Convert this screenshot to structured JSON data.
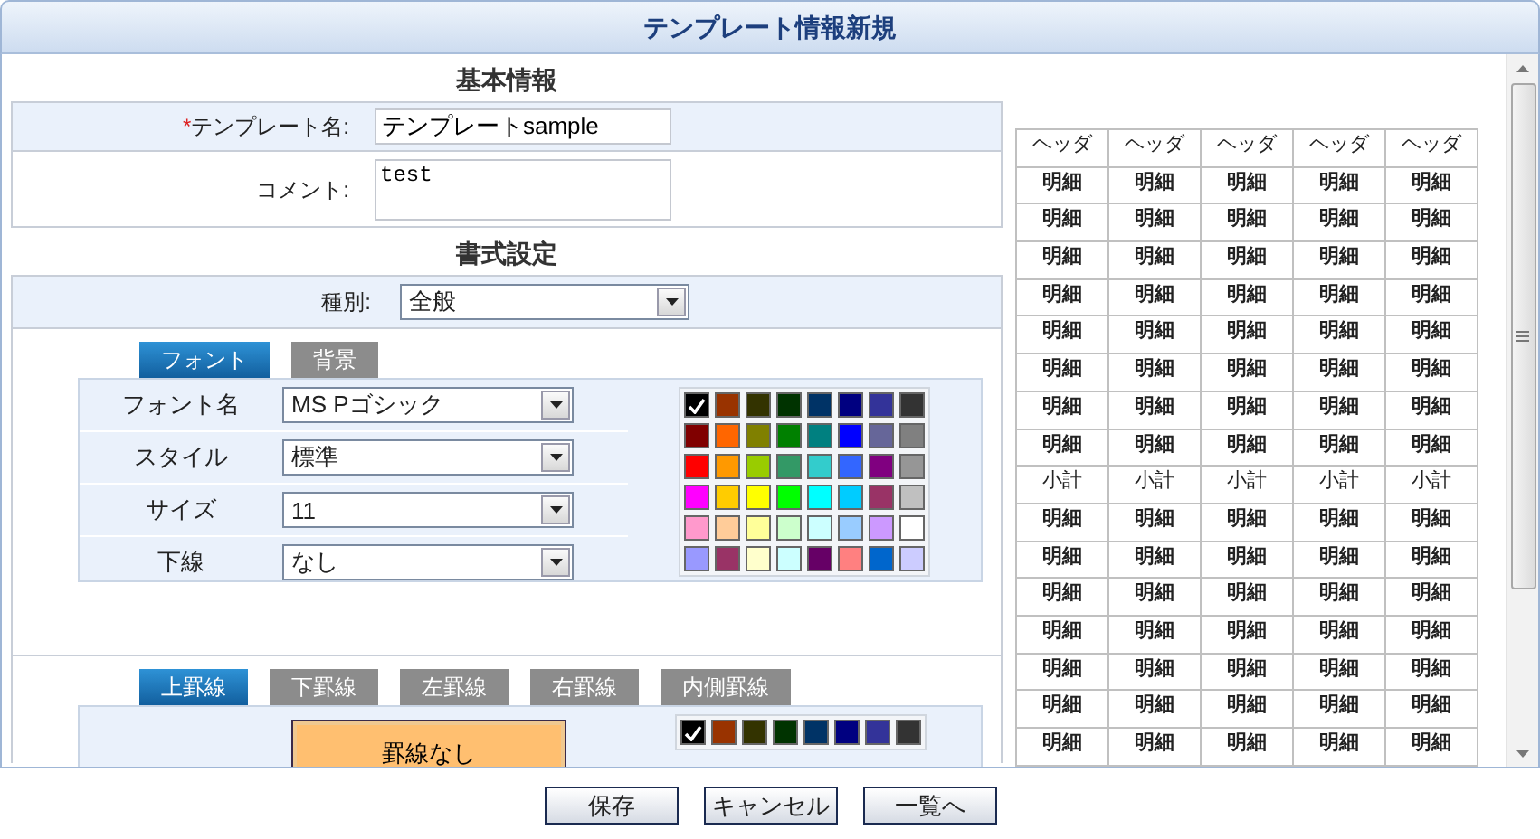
{
  "window": {
    "title": "テンプレート情報新規"
  },
  "basic_info": {
    "heading": "基本情報",
    "fields": [
      {
        "kind": "text",
        "required_mark": "*",
        "label": "テンプレート名:",
        "value": "テンプレートsample"
      },
      {
        "kind": "textarea",
        "label": "コメント:",
        "value": "test"
      }
    ]
  },
  "format_settings": {
    "heading": "書式設定",
    "type_field": {
      "label": "種別:",
      "value": "全般"
    },
    "font_tabs": [
      {
        "label": "フォント",
        "selected": true
      },
      {
        "label": "背景",
        "selected": false
      }
    ],
    "font_fields": [
      {
        "label": "フォント名",
        "value": "MS Pゴシック"
      },
      {
        "label": "スタイル",
        "value": "標準"
      },
      {
        "label": "サイズ",
        "value": "11"
      },
      {
        "label": "下線",
        "value": "なし"
      }
    ],
    "font_palette": [
      {
        "color": "#000000",
        "selected": true
      },
      {
        "color": "#993300",
        "selected": false
      },
      {
        "color": "#333300",
        "selected": false
      },
      {
        "color": "#003300",
        "selected": false
      },
      {
        "color": "#003366",
        "selected": false
      },
      {
        "color": "#000080",
        "selected": false
      },
      {
        "color": "#333399",
        "selected": false
      },
      {
        "color": "#333333",
        "selected": false
      },
      {
        "color": "#800000",
        "selected": false
      },
      {
        "color": "#ff6600",
        "selected": false
      },
      {
        "color": "#808000",
        "selected": false
      },
      {
        "color": "#008000",
        "selected": false
      },
      {
        "color": "#008080",
        "selected": false
      },
      {
        "color": "#0000ff",
        "selected": false
      },
      {
        "color": "#666699",
        "selected": false
      },
      {
        "color": "#808080",
        "selected": false
      },
      {
        "color": "#ff0000",
        "selected": false
      },
      {
        "color": "#ff9900",
        "selected": false
      },
      {
        "color": "#99cc00",
        "selected": false
      },
      {
        "color": "#339966",
        "selected": false
      },
      {
        "color": "#33cccc",
        "selected": false
      },
      {
        "color": "#3366ff",
        "selected": false
      },
      {
        "color": "#800080",
        "selected": false
      },
      {
        "color": "#969696",
        "selected": false
      },
      {
        "color": "#ff00ff",
        "selected": false
      },
      {
        "color": "#ffcc00",
        "selected": false
      },
      {
        "color": "#ffff00",
        "selected": false
      },
      {
        "color": "#00ff00",
        "selected": false
      },
      {
        "color": "#00ffff",
        "selected": false
      },
      {
        "color": "#00ccff",
        "selected": false
      },
      {
        "color": "#993366",
        "selected": false
      },
      {
        "color": "#c0c0c0",
        "selected": false
      },
      {
        "color": "#ff99cc",
        "selected": false
      },
      {
        "color": "#ffcc99",
        "selected": false
      },
      {
        "color": "#ffff99",
        "selected": false
      },
      {
        "color": "#ccffcc",
        "selected": false
      },
      {
        "color": "#ccffff",
        "selected": false
      },
      {
        "color": "#99ccff",
        "selected": false
      },
      {
        "color": "#cc99ff",
        "selected": false
      },
      {
        "color": "#ffffff",
        "selected": false
      },
      {
        "color": "#9999ff",
        "selected": false
      },
      {
        "color": "#993366",
        "selected": false
      },
      {
        "color": "#ffffcc",
        "selected": false
      },
      {
        "color": "#ccffff",
        "selected": false
      },
      {
        "color": "#660066",
        "selected": false
      },
      {
        "color": "#ff8080",
        "selected": false
      },
      {
        "color": "#0066cc",
        "selected": false
      },
      {
        "color": "#ccccff",
        "selected": false
      }
    ],
    "border_tabs": [
      {
        "label": "上罫線",
        "selected": true
      },
      {
        "label": "下罫線",
        "selected": false
      },
      {
        "label": "左罫線",
        "selected": false
      },
      {
        "label": "右罫線",
        "selected": false
      },
      {
        "label": "内側罫線",
        "selected": false
      }
    ],
    "border_style": {
      "label": "罫線なし",
      "selected": true
    },
    "border_palette": [
      {
        "color": "#000000",
        "selected": true
      },
      {
        "color": "#993300",
        "selected": false
      },
      {
        "color": "#333300",
        "selected": false
      },
      {
        "color": "#003300",
        "selected": false
      },
      {
        "color": "#003366",
        "selected": false
      },
      {
        "color": "#000080",
        "selected": false
      },
      {
        "color": "#333399",
        "selected": false
      },
      {
        "color": "#333333",
        "selected": false
      }
    ]
  },
  "preview": {
    "columns": [
      "ヘッダ",
      "ヘッダ",
      "ヘッダ",
      "ヘッダ",
      "ヘッダ"
    ],
    "rows": [
      {
        "kind": "detail",
        "cells": [
          "明細",
          "明細",
          "明細",
          "明細",
          "明細"
        ]
      },
      {
        "kind": "detail",
        "cells": [
          "明細",
          "明細",
          "明細",
          "明細",
          "明細"
        ]
      },
      {
        "kind": "detail",
        "cells": [
          "明細",
          "明細",
          "明細",
          "明細",
          "明細"
        ]
      },
      {
        "kind": "detail",
        "cells": [
          "明細",
          "明細",
          "明細",
          "明細",
          "明細"
        ]
      },
      {
        "kind": "detail",
        "cells": [
          "明細",
          "明細",
          "明細",
          "明細",
          "明細"
        ]
      },
      {
        "kind": "detail",
        "cells": [
          "明細",
          "明細",
          "明細",
          "明細",
          "明細"
        ]
      },
      {
        "kind": "detail",
        "cells": [
          "明細",
          "明細",
          "明細",
          "明細",
          "明細"
        ]
      },
      {
        "kind": "detail",
        "cells": [
          "明細",
          "明細",
          "明細",
          "明細",
          "明細"
        ]
      },
      {
        "kind": "subtotal",
        "cells": [
          "小計",
          "小計",
          "小計",
          "小計",
          "小計"
        ]
      },
      {
        "kind": "detail",
        "cells": [
          "明細",
          "明細",
          "明細",
          "明細",
          "明細"
        ]
      },
      {
        "kind": "detail",
        "cells": [
          "明細",
          "明細",
          "明細",
          "明細",
          "明細"
        ]
      },
      {
        "kind": "detail",
        "cells": [
          "明細",
          "明細",
          "明細",
          "明細",
          "明細"
        ]
      },
      {
        "kind": "detail",
        "cells": [
          "明細",
          "明細",
          "明細",
          "明細",
          "明細"
        ]
      },
      {
        "kind": "detail",
        "cells": [
          "明細",
          "明細",
          "明細",
          "明細",
          "明細"
        ]
      },
      {
        "kind": "detail",
        "cells": [
          "明細",
          "明細",
          "明細",
          "明細",
          "明細"
        ]
      },
      {
        "kind": "detail",
        "cells": [
          "明細",
          "明細",
          "明細",
          "明細",
          "明細"
        ]
      }
    ]
  },
  "buttons": [
    "保存",
    "キャンセル",
    "一覧へ"
  ]
}
